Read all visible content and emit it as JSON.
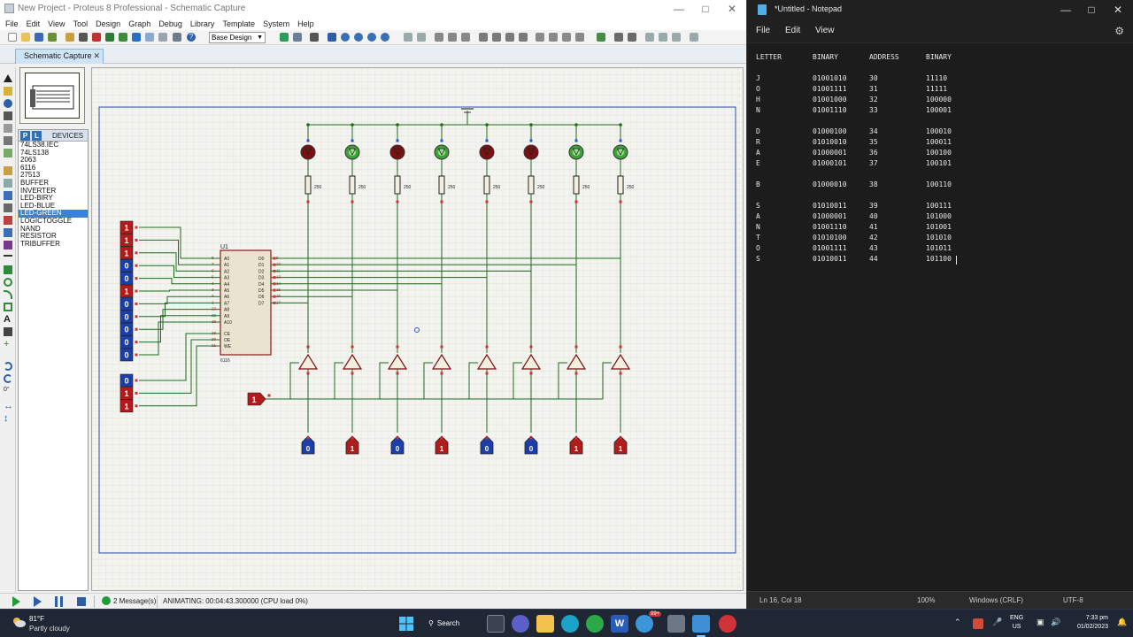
{
  "proteus": {
    "title": "New Project - Proteus 8 Professional - Schematic Capture",
    "menu": [
      "File",
      "Edit",
      "View",
      "Tool",
      "Design",
      "Graph",
      "Debug",
      "Library",
      "Template",
      "System",
      "Help"
    ],
    "design_select": "Base Design",
    "tab": "Schematic Capture",
    "devices_header": "DEVICES",
    "pick_p": "P",
    "pick_l": "L",
    "devices": [
      "74LS38.IEC",
      "74LS138",
      "2063",
      "6116",
      "27513",
      "BUFFER",
      "INVERTER",
      "LED-BIRY",
      "LED-BLUE",
      "LED-GREEN",
      "LOGICTOGGLE",
      "NAND",
      "RESISTOR",
      "TRIBUFFER"
    ],
    "selected_device": "LED-GREEN",
    "messages": "2 Message(s)",
    "status": "ANIMATING: 00:04:43.300000 (CPU load 0%)",
    "rotation": "0°",
    "schematic": {
      "chip_ref": "U1",
      "chip_part": "6116",
      "addr_pins": [
        "A0",
        "A1",
        "A2",
        "A3",
        "A4",
        "A5",
        "A6",
        "A7",
        "A8",
        "A9",
        "A10"
      ],
      "addr_pin_nums": [
        "8",
        "7",
        "6",
        "5",
        "4",
        "3",
        "2",
        "1",
        "23",
        "22",
        "19"
      ],
      "data_pins": [
        "D0",
        "D1",
        "D2",
        "D3",
        "D4",
        "D5",
        "D6",
        "D7"
      ],
      "data_pin_nums": [
        "9",
        "10",
        "11",
        "13",
        "14",
        "15",
        "16",
        "17"
      ],
      "ctrl_pins": [
        "CE",
        "OE",
        "WE"
      ],
      "ctrl_pin_nums": [
        "18",
        "20",
        "21"
      ],
      "address_toggles": [
        "1",
        "1",
        "1",
        "0",
        "0",
        "1",
        "0",
        "0",
        "0",
        "0",
        "0"
      ],
      "control_toggles": [
        "0",
        "1",
        "1"
      ],
      "enable_toggle": "1",
      "resistor_value": "250",
      "leds_on": [
        false,
        true,
        false,
        true,
        false,
        false,
        true,
        true
      ],
      "data_toggles": [
        "0",
        "1",
        "0",
        "1",
        "0",
        "0",
        "1",
        "1"
      ]
    }
  },
  "notepad": {
    "title": "*Untitled - Notepad",
    "menu": [
      "File",
      "Edit",
      "View"
    ],
    "headers": [
      "LETTER",
      "BINARY",
      "ADDRESS",
      "BINARY"
    ],
    "groups": [
      [
        [
          "J",
          "01001010",
          "30",
          "11110"
        ],
        [
          "O",
          "01001111",
          "31",
          "11111"
        ],
        [
          "H",
          "01001000",
          "32",
          "100000"
        ],
        [
          "N",
          "01001110",
          "33",
          "100001"
        ]
      ],
      [
        [
          "D",
          "01000100",
          "34",
          "100010"
        ],
        [
          "R",
          "01010010",
          "35",
          "100011"
        ],
        [
          "A",
          "01000001",
          "36",
          "100100"
        ],
        [
          "E",
          "01000101",
          "37",
          "100101"
        ]
      ],
      [
        [
          "B",
          "01000010",
          "38",
          "100110"
        ]
      ],
      [
        [
          "S",
          "01010011",
          "39",
          "100111"
        ],
        [
          "A",
          "01000001",
          "40",
          "101000"
        ],
        [
          "N",
          "01001110",
          "41",
          "101001"
        ],
        [
          "T",
          "01010100",
          "42",
          "101010"
        ],
        [
          "O",
          "01001111",
          "43",
          "101011"
        ],
        [
          "S",
          "01010011",
          "44",
          "101100"
        ]
      ]
    ],
    "status": {
      "position": "Ln 16, Col 18",
      "zoom": "100%",
      "line_ending": "Windows (CRLF)",
      "encoding": "UTF-8"
    }
  },
  "taskbar": {
    "temp": "81°F",
    "weather": "Partly cloudy",
    "search": "Search",
    "lang_top": "ENG",
    "lang_bottom": "US",
    "time": "7:33 pm",
    "date": "01/02/2023",
    "badge": "99+"
  },
  "colors": {
    "wire": "#1d6b1d",
    "toggle_red": "#b11b1b",
    "toggle_blue": "#1b3ea8",
    "chip_fill": "#e9e3cf",
    "chip_border": "#8b1a1a",
    "grid_bg": "#f3f3ef"
  }
}
